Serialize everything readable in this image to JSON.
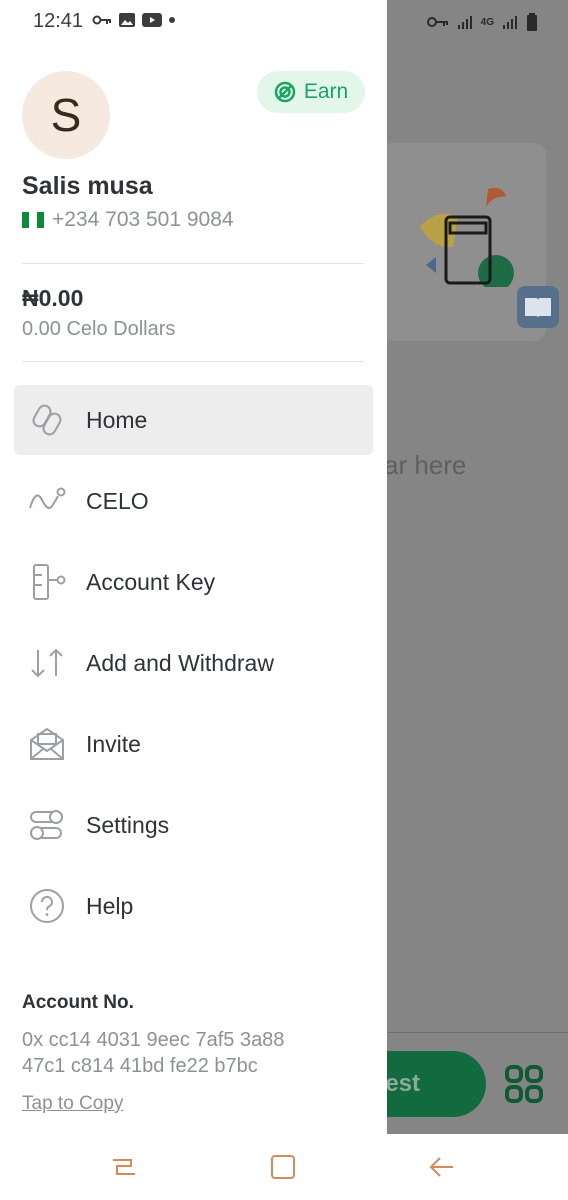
{
  "status_bar": {
    "time": "12:41",
    "network": "4G"
  },
  "profile": {
    "avatar_initial": "S",
    "name": "Salis musa",
    "phone": "+234 703 501 9084"
  },
  "earn_button": {
    "label": "Earn"
  },
  "balance": {
    "local": "₦0.00",
    "celo": "0.00 Celo Dollars"
  },
  "menu": [
    {
      "label": "Home",
      "icon": "home-icon",
      "active": true
    },
    {
      "label": "CELO",
      "icon": "celo-icon",
      "active": false
    },
    {
      "label": "Account Key",
      "icon": "account-key-icon",
      "active": false
    },
    {
      "label": "Add and Withdraw",
      "icon": "arrows-up-down-icon",
      "active": false
    },
    {
      "label": "Invite",
      "icon": "envelope-icon",
      "active": false
    },
    {
      "label": "Settings",
      "icon": "settings-icon",
      "active": false
    },
    {
      "label": "Help",
      "icon": "help-icon",
      "active": false
    }
  ],
  "account": {
    "title": "Account No.",
    "address_line1": "0x cc14 4031 9eec 7af5 3a88",
    "address_line2": "47c1 c814 41bd fe22 b7bc",
    "copy_label": "Tap to Copy"
  },
  "background": {
    "partial_text": "ar here",
    "request_partial": "est"
  },
  "colors": {
    "accent": "#1aa463",
    "earn_bg": "#e3f6ea",
    "active_item_bg": "#ededee",
    "nav_icon": "#d58a5a"
  }
}
